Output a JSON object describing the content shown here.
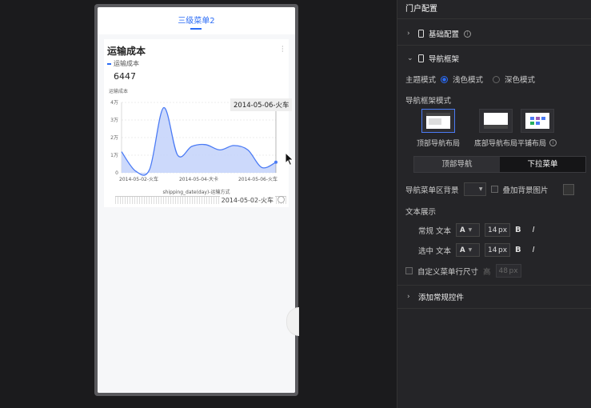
{
  "preview": {
    "menu_tab": "三级菜单2",
    "card": {
      "title": "运输成本",
      "legend": "运输成本",
      "value": "6447",
      "y_axis_label": "运输成本",
      "tooltip": "2014-05-06-火车",
      "x_axis_name": "shipping_date(day)-运输方式",
      "slider_label": "2014-05-02-火车"
    }
  },
  "chart_data": {
    "type": "area",
    "series": [
      {
        "name": "运输成本",
        "values": [
          1.2,
          0.1,
          0.2,
          3.7,
          1.0,
          1.5,
          1.6,
          1.3,
          1.55,
          1.3,
          0.3,
          0.6
        ]
      }
    ],
    "x_tick_labels": [
      "2014-05-02-火车",
      "2014-05-04-大卡",
      "2014-05-06-火车"
    ],
    "y_tick_labels": [
      "4万",
      "3万",
      "2万",
      "1万",
      "0"
    ],
    "ylim": [
      0,
      4
    ],
    "grid": true,
    "color": "#4b7bf5"
  },
  "panel": {
    "title": "门户配置",
    "basic_config": "基础配置",
    "nav_frame": "导航框架",
    "theme_mode_label": "主题模式",
    "theme_light": "浅色模式",
    "theme_dark": "深色模式",
    "frame_mode_label": "导航框架模式",
    "layout_top": "顶部导航布局",
    "layout_bottom": "底部导航布局",
    "layout_tile": "平铺布局",
    "seg_top_nav": "顶部导航",
    "seg_dropdown": "下拉菜单",
    "menu_bg_label": "导航菜单区背景",
    "overlay_bg_label": "叠加背景图片",
    "text_display_label": "文本展示",
    "normal_text_label": "常规 文本",
    "selected_text_label": "选中 文本",
    "font_glyph": "A",
    "normal_size": "14",
    "selected_size": "14",
    "unit": "px",
    "bold": "B",
    "italic": "I",
    "custom_row_size_label": "自定义菜单行尺寸",
    "height_label": "高",
    "height_value": "48",
    "add_controls": "添加常规控件"
  }
}
